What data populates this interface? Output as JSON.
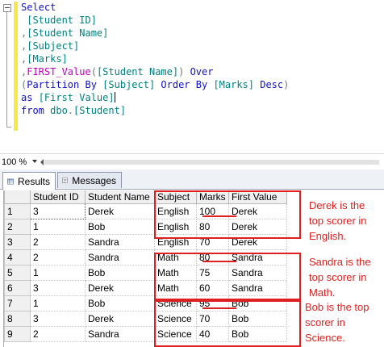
{
  "editor": {
    "lines": [
      {
        "parts": [
          {
            "t": "Select",
            "c": "kw"
          }
        ]
      },
      {
        "parts": [
          {
            "t": " ",
            "c": ""
          },
          {
            "t": "[Student ID]",
            "c": "id"
          }
        ]
      },
      {
        "parts": [
          {
            "t": ",",
            "c": "sep"
          },
          {
            "t": "[Student Name]",
            "c": "id"
          }
        ]
      },
      {
        "parts": [
          {
            "t": ",",
            "c": "sep"
          },
          {
            "t": "[Subject]",
            "c": "id"
          }
        ]
      },
      {
        "parts": [
          {
            "t": ",",
            "c": "sep"
          },
          {
            "t": "[Marks]",
            "c": "id"
          }
        ]
      },
      {
        "parts": [
          {
            "t": ",",
            "c": "sep"
          },
          {
            "t": "FIRST_Value",
            "c": "fn"
          },
          {
            "t": "(",
            "c": "sep"
          },
          {
            "t": "[Student Name]",
            "c": "id"
          },
          {
            "t": ") ",
            "c": "sep"
          },
          {
            "t": "Over",
            "c": "kw"
          }
        ]
      },
      {
        "parts": [
          {
            "t": "(",
            "c": "sep"
          },
          {
            "t": "Partition By ",
            "c": "kw"
          },
          {
            "t": "[Subject] ",
            "c": "id"
          },
          {
            "t": "Order By ",
            "c": "kw"
          },
          {
            "t": "[Marks] ",
            "c": "id"
          },
          {
            "t": "Desc",
            "c": "kw"
          },
          {
            "t": ")",
            "c": "sep"
          }
        ]
      },
      {
        "parts": [
          {
            "t": "as ",
            "c": "kw"
          },
          {
            "t": "[First Value]",
            "c": "id"
          }
        ],
        "caret": true
      },
      {
        "parts": [
          {
            "t": "from ",
            "c": "kw"
          },
          {
            "t": "dbo",
            "c": "id"
          },
          {
            "t": ".",
            "c": "sep"
          },
          {
            "t": "[Student]",
            "c": "id"
          }
        ]
      }
    ]
  },
  "zoom": {
    "value": "100 %"
  },
  "tabs": {
    "results": "Results",
    "messages": "Messages"
  },
  "grid": {
    "columns": [
      "Student ID",
      "Student Name",
      "Subject",
      "Marks",
      "First Value"
    ],
    "rows": [
      {
        "num": "1",
        "cells": [
          "3",
          "Derek",
          "English",
          "100",
          "Derek"
        ]
      },
      {
        "num": "2",
        "cells": [
          "1",
          "Bob",
          "English",
          "80",
          "Derek"
        ]
      },
      {
        "num": "3",
        "cells": [
          "2",
          "Sandra",
          "English",
          "70",
          "Derek"
        ]
      },
      {
        "num": "4",
        "cells": [
          "2",
          "Sandra",
          "Math",
          "80",
          "Sandra"
        ]
      },
      {
        "num": "5",
        "cells": [
          "1",
          "Bob",
          "Math",
          "75",
          "Sandra"
        ]
      },
      {
        "num": "6",
        "cells": [
          "3",
          "Derek",
          "Math",
          "60",
          "Sandra"
        ]
      },
      {
        "num": "7",
        "cells": [
          "1",
          "Bob",
          "Science",
          "95",
          "Bob"
        ]
      },
      {
        "num": "8",
        "cells": [
          "3",
          "Derek",
          "Science",
          "70",
          "Bob"
        ]
      },
      {
        "num": "9",
        "cells": [
          "2",
          "Sandra",
          "Science",
          "40",
          "Bob"
        ]
      }
    ]
  },
  "annotations": {
    "english": [
      "Derek is the",
      "top scorer in",
      "English."
    ],
    "math": [
      "Sandra is the",
      "top scorer in",
      "Math."
    ],
    "science": [
      "Bob is the top",
      "scorer in",
      "Science."
    ],
    "color": "#e02020"
  }
}
